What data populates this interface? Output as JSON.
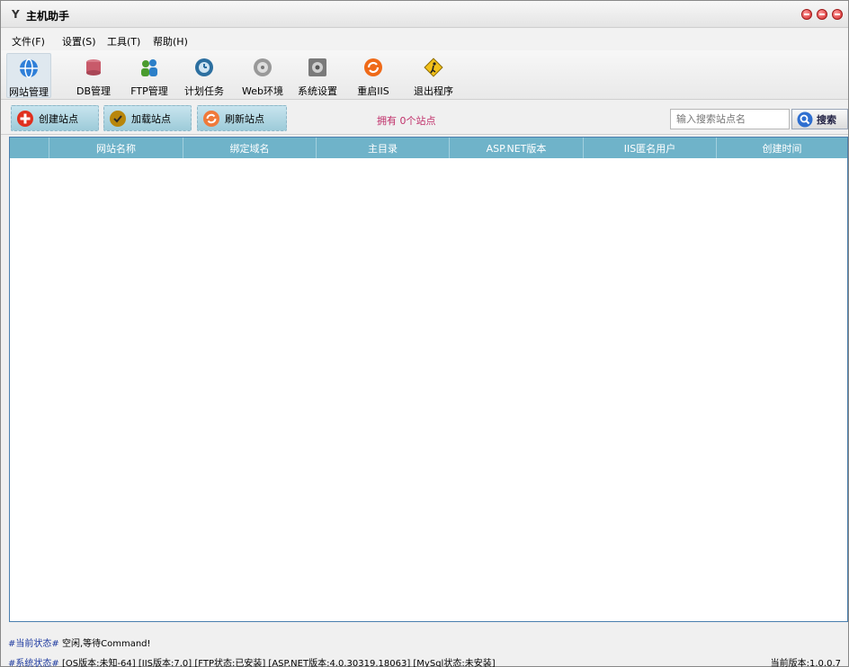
{
  "window": {
    "title": "主机助手",
    "logo": "Y"
  },
  "menu": [
    {
      "label": "文件(F)"
    },
    {
      "label": "设置(S)"
    },
    {
      "label": "工具(T)"
    },
    {
      "label": "帮助(H)"
    }
  ],
  "toolbar": [
    {
      "label": "网站管理",
      "icon": "globe-icon",
      "color": "#2f7fd8"
    },
    {
      "label": "DB管理",
      "icon": "database-icon",
      "color": "#c85a6a"
    },
    {
      "label": "FTP管理",
      "icon": "users-icon",
      "color": "#4a9b2f"
    },
    {
      "label": "计划任务",
      "icon": "clock-icon",
      "color": "#2c6fa0"
    },
    {
      "label": "Web环境",
      "icon": "web-env-icon",
      "color": "#888888"
    },
    {
      "label": "系统设置",
      "icon": "settings-icon",
      "color": "#666666"
    },
    {
      "label": "重启IIS",
      "icon": "restart-icon",
      "color": "#ef6a18"
    },
    {
      "label": "退出程序",
      "icon": "exit-icon",
      "color": "#e0a800"
    }
  ],
  "actions": {
    "create": "创建站点",
    "load": "加载站点",
    "refresh": "刷新站点",
    "site_count": "拥有 0个站点",
    "search_placeholder": "输入搜索站点名",
    "search_button": "搜索"
  },
  "table": {
    "columns": [
      "网站名称",
      "绑定域名",
      "主目录",
      "ASP.NET版本",
      "IIS匿名用户",
      "创建时间"
    ],
    "rows": []
  },
  "status": {
    "current_tag": "#当前状态#",
    "current_text": "空闲,等待Command!",
    "system_tag": "#系统状态#",
    "system_text": "[OS版本:未知-64] [IIS版本:7.0] [FTP状态:已安装] [ASP.NET版本:4.0.30319.18063] [MySql状态:未安装]",
    "version": "当前版本:1.0.0.7"
  }
}
